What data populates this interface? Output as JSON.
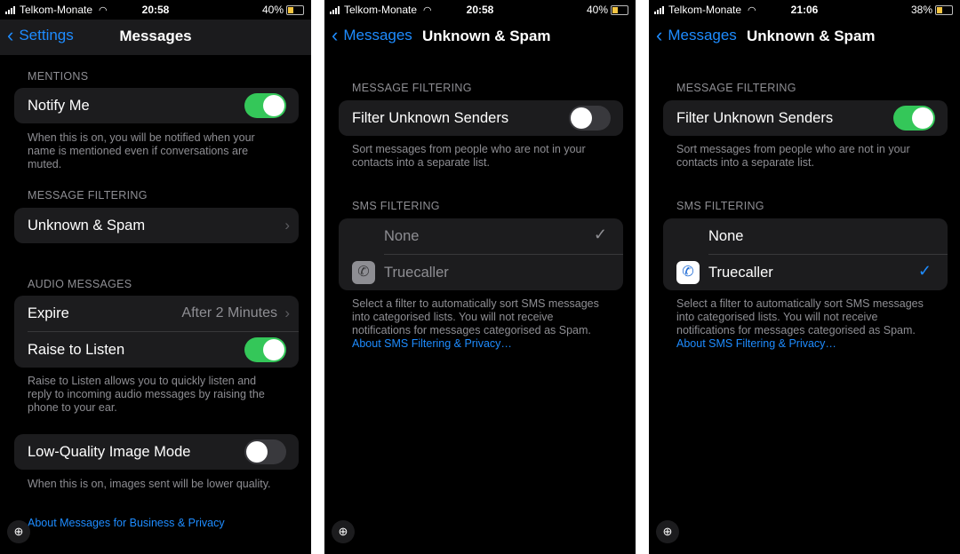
{
  "screens": [
    {
      "status": {
        "carrier": "Telkom-Monate",
        "time": "20:58",
        "battery": "40%",
        "battery_level": 0.4
      },
      "nav": {
        "back_label": "Settings",
        "title": "Messages"
      },
      "mentions_header": "MENTIONS",
      "notify_me": {
        "label": "Notify Me",
        "on": true
      },
      "mentions_footer": "When this is on, you will be notified when your name is mentioned even if conversations are muted.",
      "filtering_header": "MESSAGE FILTERING",
      "unknown_spam_label": "Unknown & Spam",
      "audio_header": "AUDIO MESSAGES",
      "expire": {
        "label": "Expire",
        "value": "After 2 Minutes"
      },
      "raise_to_listen": {
        "label": "Raise to Listen",
        "on": true
      },
      "audio_footer": "Raise to Listen allows you to quickly listen and reply to incoming audio messages by raising the phone to your ear.",
      "low_quality": {
        "label": "Low-Quality Image Mode",
        "on": false
      },
      "low_quality_footer": "When this is on, images sent will be lower quality.",
      "business_link": "About Messages for Business & Privacy"
    },
    {
      "status": {
        "carrier": "Telkom-Monate",
        "time": "20:58",
        "battery": "40%",
        "battery_level": 0.4
      },
      "nav": {
        "back_label": "Messages",
        "title": "Unknown & Spam"
      },
      "filtering_header": "MESSAGE FILTERING",
      "filter_unknown": {
        "label": "Filter Unknown Senders",
        "on": false
      },
      "filter_footer": "Sort messages from people who are not in your contacts into a separate list.",
      "sms_header": "SMS FILTERING",
      "options": [
        {
          "label": "None",
          "selected": true
        },
        {
          "label": "Truecaller",
          "selected": false
        }
      ],
      "sms_footer": "Select a filter to automatically sort SMS messages into categorised lists. You will not receive notifications for messages categorised as Spam.",
      "sms_link": "About SMS Filtering & Privacy…"
    },
    {
      "status": {
        "carrier": "Telkom-Monate",
        "time": "21:06",
        "battery": "38%",
        "battery_level": 0.38
      },
      "nav": {
        "back_label": "Messages",
        "title": "Unknown & Spam"
      },
      "filtering_header": "MESSAGE FILTERING",
      "filter_unknown": {
        "label": "Filter Unknown Senders",
        "on": true
      },
      "filter_footer": "Sort messages from people who are not in your contacts into a separate list.",
      "sms_header": "SMS FILTERING",
      "options": [
        {
          "label": "None",
          "selected": false
        },
        {
          "label": "Truecaller",
          "selected": true
        }
      ],
      "sms_footer": "Select a filter to automatically sort SMS messages into categorised lists. You will not receive notifications for messages categorised as Spam.",
      "sms_link": "About SMS Filtering & Privacy…"
    }
  ],
  "icons": {
    "back": "chevron-left-icon",
    "disclosure": "chevron-right-icon",
    "check": "checkmark-icon",
    "zoom": "zoom-in-icon",
    "app": "truecaller-phone-icon",
    "signal": "signal-bars-icon",
    "wifi": "wifi-icon",
    "battery": "battery-icon"
  },
  "colors": {
    "accent": "#1e8cff",
    "toggle_on": "#34c759",
    "battery_fill": "#f4c542"
  }
}
